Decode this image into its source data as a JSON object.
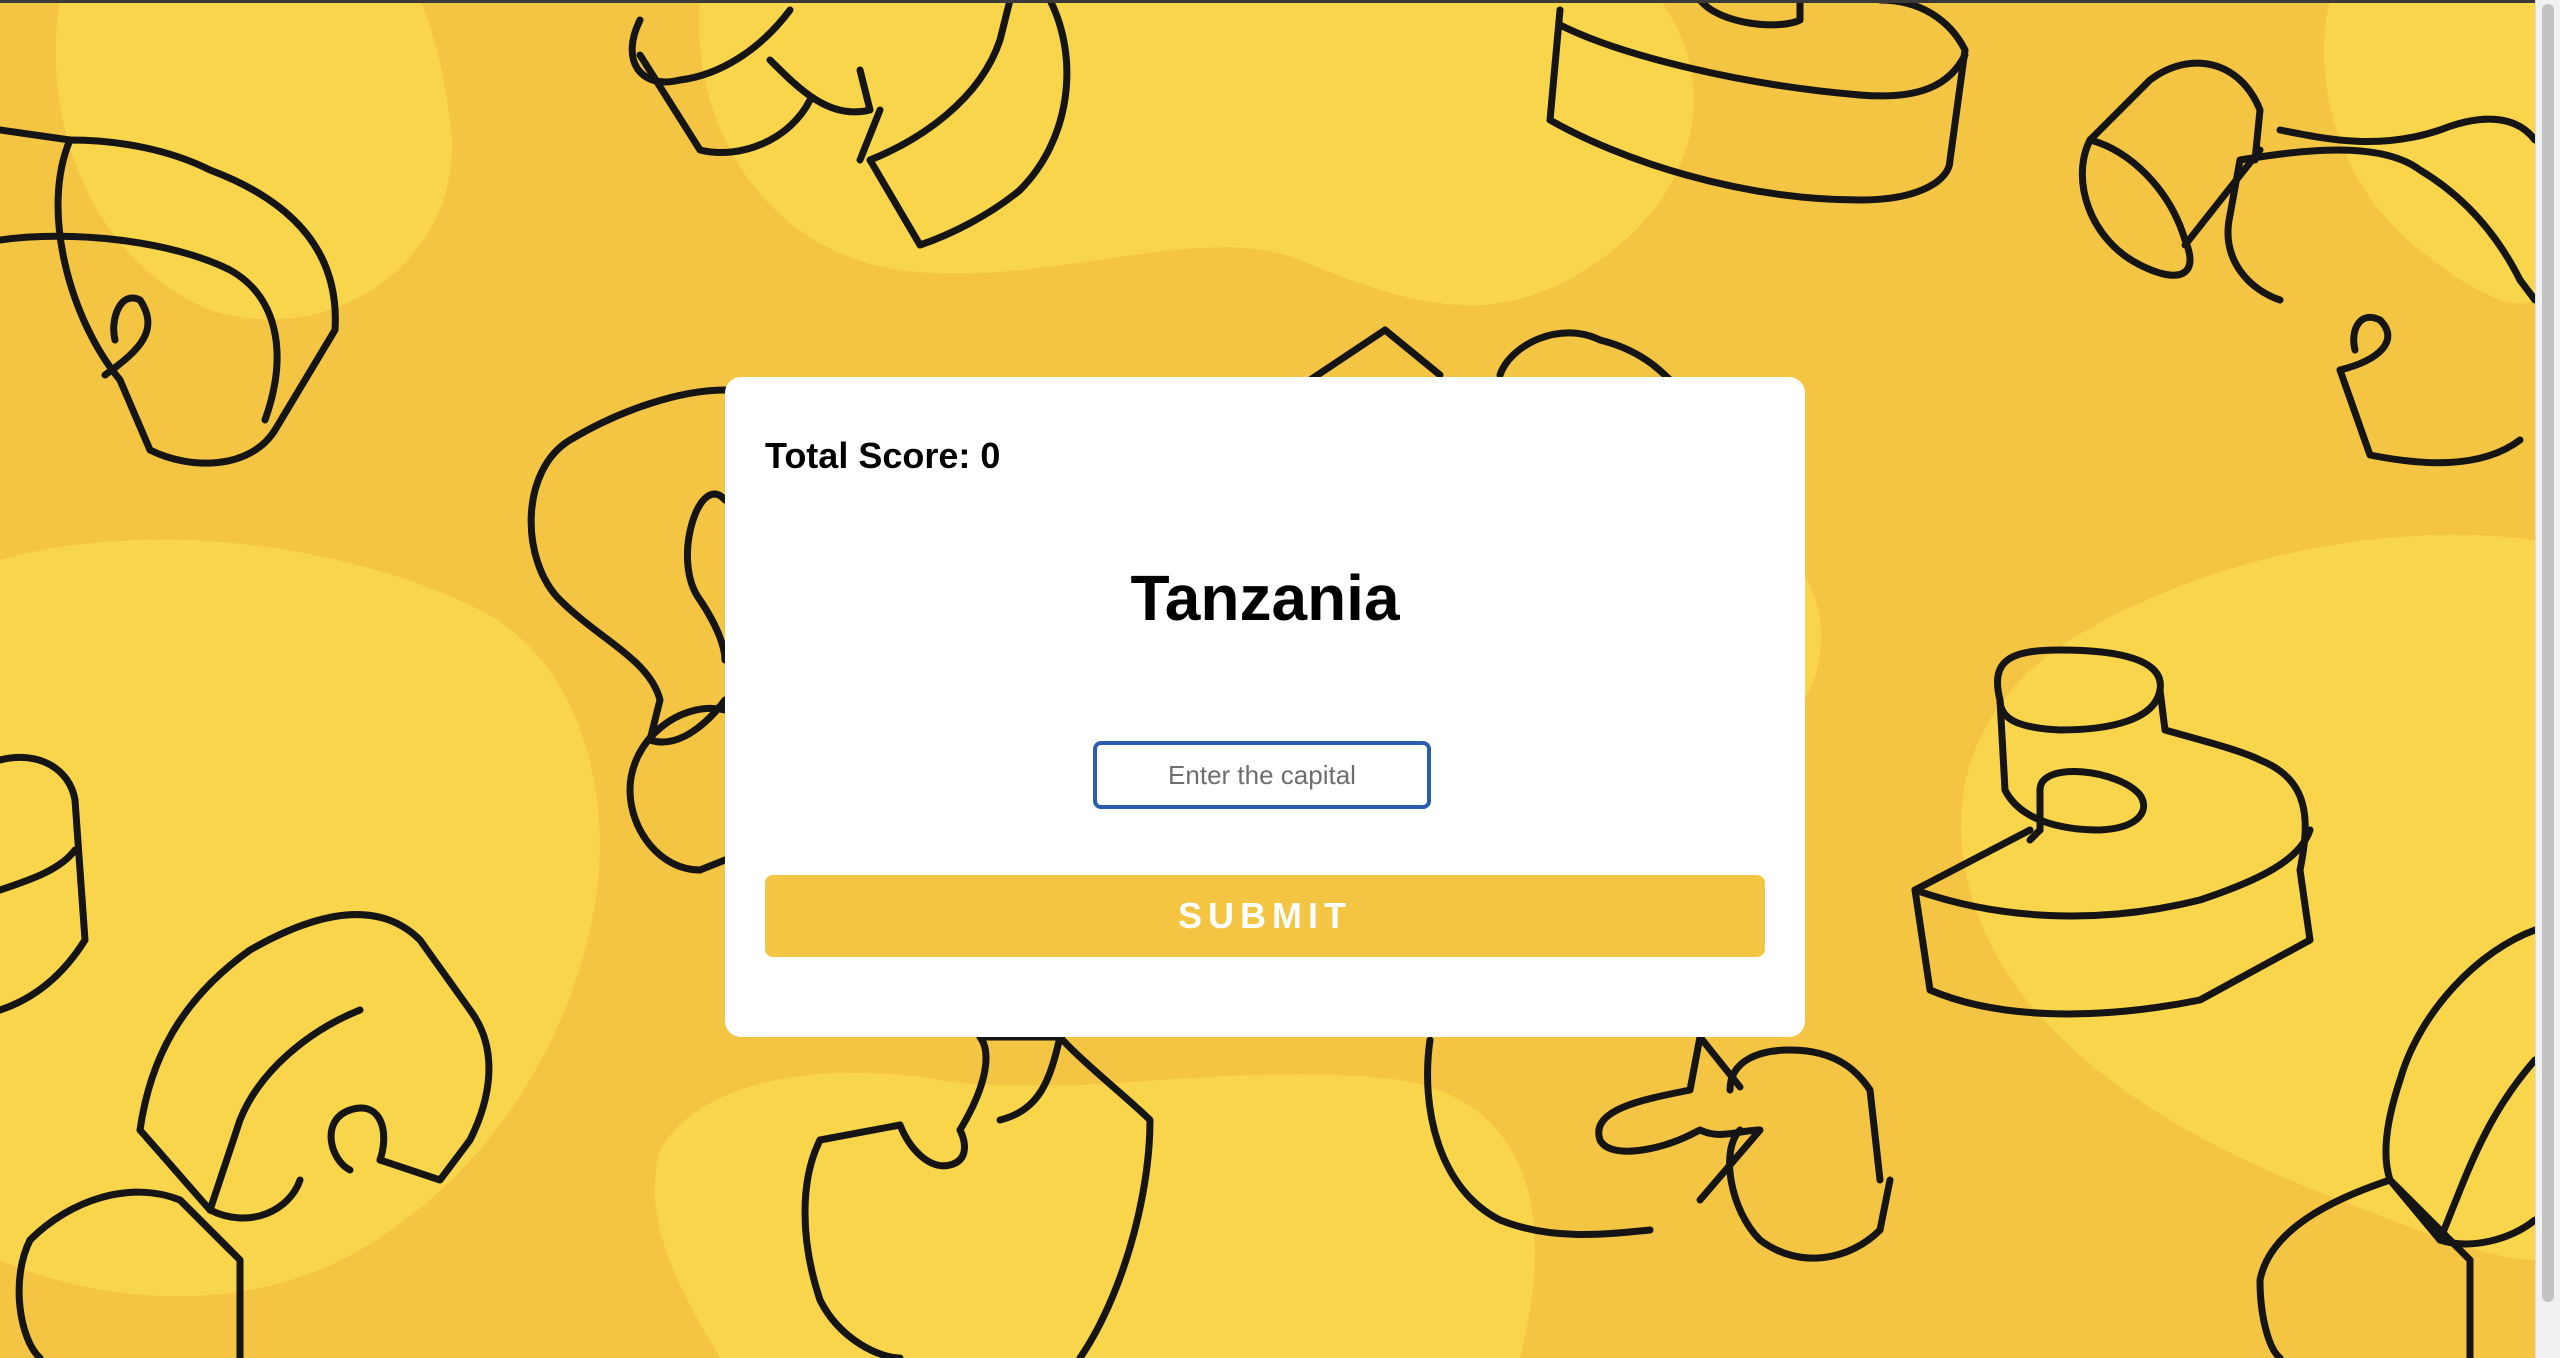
{
  "quiz": {
    "score_label": "Total Score: 0",
    "country": "Tanzania",
    "answer_placeholder": "Enter the capital",
    "answer_value": "",
    "submit_label": "SUBMIT"
  },
  "colors": {
    "background": "#f4c443",
    "background_blob": "#f9d54b",
    "card": "#ffffff",
    "submit_button": "#f4c443",
    "input_border": "#2a5db0",
    "outline": "#151515"
  },
  "background_pattern": {
    "description_icon": "3d-curly-bracket-shapes-pattern"
  }
}
